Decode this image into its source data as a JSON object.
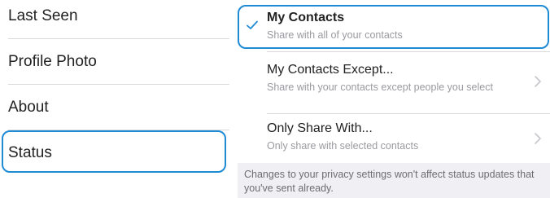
{
  "privacy_list": {
    "items": [
      {
        "label": "Last Seen"
      },
      {
        "label": "Profile Photo"
      },
      {
        "label": "About"
      },
      {
        "label": "Status"
      }
    ],
    "selected": "Status"
  },
  "status_options": {
    "options": [
      {
        "title": "My Contacts",
        "subtitle": "Share with all of your contacts",
        "selected": true
      },
      {
        "title": "My Contacts Except...",
        "subtitle": "Share with your contacts except people you select",
        "selected": false
      },
      {
        "title": "Only Share With...",
        "subtitle": "Only share with selected contacts",
        "selected": false
      }
    ],
    "footer_note": "Changes to your privacy settings won't affect status updates that you've sent already."
  },
  "colors": {
    "accent": "#1f8bd4",
    "secondary_text": "#9a9aa0",
    "grouped_background": "#efeff4"
  },
  "icons": {
    "selected_marker": "checkmark-icon",
    "disclosure": "chevron-right-icon"
  }
}
